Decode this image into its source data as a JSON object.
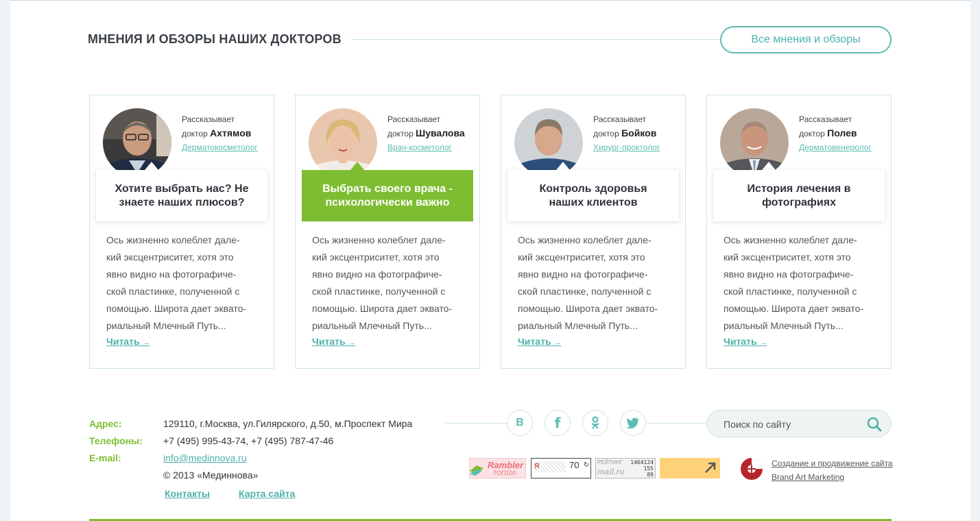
{
  "section": {
    "title": "Мнения и обзоры наших докторов",
    "all_button": "Все мнения и обзоры"
  },
  "cards": [
    {
      "intro": "Рассказывает",
      "doctor_prefix": "доктор",
      "doctor_name": "Ахтямов",
      "specialty": "Дерматокосметолог",
      "question": "Хотите выбрать нас? Не знаете наших плюсов?",
      "active": false,
      "text_lines": [
        "Ось жизненно колеблет дале-",
        "кий эксцентриситет, хотя это",
        "явно видно на фотографиче-",
        "ской пластинке, полученной с",
        "помощью. Широта дает эквато-",
        "риальный Млечный Путь..."
      ],
      "read": "Читать",
      "read_arrow": "→"
    },
    {
      "intro": "Рассказывает",
      "doctor_prefix": "доктор",
      "doctor_name": "Шувалова",
      "specialty": "Врач-косметолог",
      "question": "Выбрать своего врача - психологически важно",
      "active": true,
      "text_lines": [
        "Ось жизненно колеблет дале-",
        "кий эксцентриситет, хотя это",
        "явно видно на фотографиче-",
        "ской пластинке, полученной с",
        "помощью. Широта дает эквато-",
        "риальный Млечный Путь..."
      ],
      "read": "Читать",
      "read_arrow": "→"
    },
    {
      "intro": "Рассказывает",
      "doctor_prefix": "доктор",
      "doctor_name": "Бойков",
      "specialty": "Хирург-проктолог",
      "question": "Контроль здоровья наших клиентов",
      "active": false,
      "text_lines": [
        "Ось жизненно колеблет дале-",
        "кий эксцентриситет, хотя это",
        "явно видно на фотографиче-",
        "ской пластинке, полученной с",
        "помощью. Широта дает эквато-",
        "риальный Млечный Путь..."
      ],
      "read": "Читать",
      "read_arrow": "→"
    },
    {
      "intro": "Рассказывает",
      "doctor_prefix": "доктор",
      "doctor_name": "Полев",
      "specialty": "Дерматовенеролог",
      "question": "История лечения в фотографиях",
      "active": false,
      "text_lines": [
        "Ось жизненно колеблет дале-",
        "кий эксцентриситет, хотя это",
        "явно видно на фотографиче-",
        "ской пластинке, полученной с",
        "помощью. Широта дает эквато-",
        "риальный Млечный Путь..."
      ],
      "read": "Читать",
      "read_arrow": "→"
    }
  ],
  "footer": {
    "address_label": "Адрес:",
    "address": "129110, г.Москва, ул.Гилярского, д.50, м.Проспект Мира",
    "phones_label": "Телефоны:",
    "phones": "+7 (495) 995-43-74, +7 (495) 787-47-46",
    "email_label": "E-mail:",
    "email": "info@medinnova.ru",
    "copyright": "© 2013 «Мединнова»",
    "nav_contacts": "Контакты",
    "nav_sitemap": "Карта сайта",
    "social": {
      "vk": "В",
      "fb": "f"
    },
    "search_placeholder": "Поиск по сайту",
    "counters": {
      "rambler_top": "Rambler",
      "rambler_bottom": "ТОП100",
      "ya_value": "70",
      "mail_title": "РЕЙТИНГ",
      "mail_n1": "1464124",
      "mail_n2": "155",
      "mail_n3": "89",
      "mail_brand": "mail.ru"
    },
    "brand_line1": "Создание и продвижение сайта",
    "brand_line2": "Brand Art Marketing"
  },
  "colors": {
    "accent_teal": "#5cbcb2",
    "accent_green": "#7ebd31",
    "border": "#cfe6e4"
  },
  "icons": [
    "vk-icon",
    "facebook-icon",
    "odnoklassniki-icon",
    "twitter-icon",
    "search-icon"
  ]
}
